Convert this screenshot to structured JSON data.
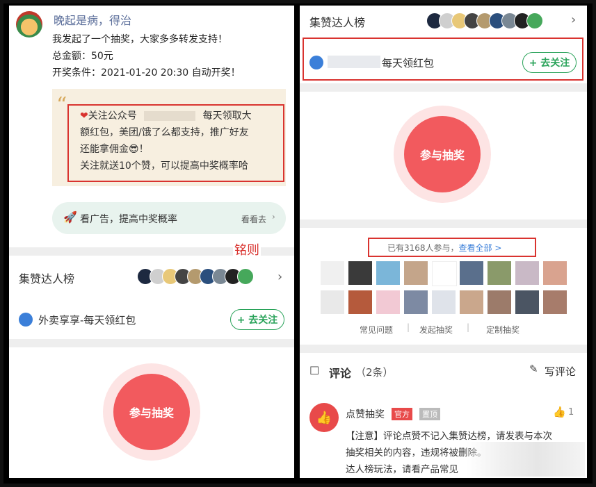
{
  "left": {
    "username": "晚起是病，得治",
    "post_line1": "我发起了一个抽奖，大家多多转发支持！",
    "post_line2": "总金额：50元",
    "post_line3": "开奖条件：2021-01-20 20:30 自动开奖！",
    "quote_line1a": "关注公众号",
    "quote_line1b": "每天领取大",
    "quote_line2": "额红包，美团/饿了么都支持，推广好友",
    "quote_line3": "还能拿佣金😎！",
    "quote_line4": "关注就送10个赞，可以提高中奖概率哈",
    "ad_text": "看广告，提高中奖概率",
    "ad_link": "看看去",
    "watermark": "铭则",
    "leaderboard_title": "集赞达人榜",
    "account_name": "外卖享享-每天领红包",
    "follow_label": "+ 去关注",
    "draw_button": "参与抽奖"
  },
  "right": {
    "leaderboard_title": "集赞达人榜",
    "account_name_suffix": "每天领红包",
    "follow_label": "+ 去关注",
    "draw_button": "参与抽奖",
    "participants_text": "已有3168人参与，",
    "view_all": "查看全部 >",
    "links": [
      "常见问题",
      "发起抽奖",
      "定制抽奖"
    ],
    "comments_title": "评论",
    "comments_count": "（2条）",
    "write_comment": "写评论",
    "commenter": "点赞抽奖",
    "badge_official": "官方",
    "badge_pinned": "置顶",
    "like_count": "1",
    "comment_line1": "【注意】评论点赞不记入集赞达榜，请发表与本次",
    "comment_line2": "抽奖相关的内容，违规将被删除。",
    "comment_line3": "达人榜玩法，请看产品常见"
  },
  "colors": {
    "accent_red": "#f25a5e",
    "follow_green": "#2aa35a",
    "highlight_red": "#d9332f",
    "link_blue": "#3b7fd9",
    "ad_bg": "#e8f3ee"
  }
}
